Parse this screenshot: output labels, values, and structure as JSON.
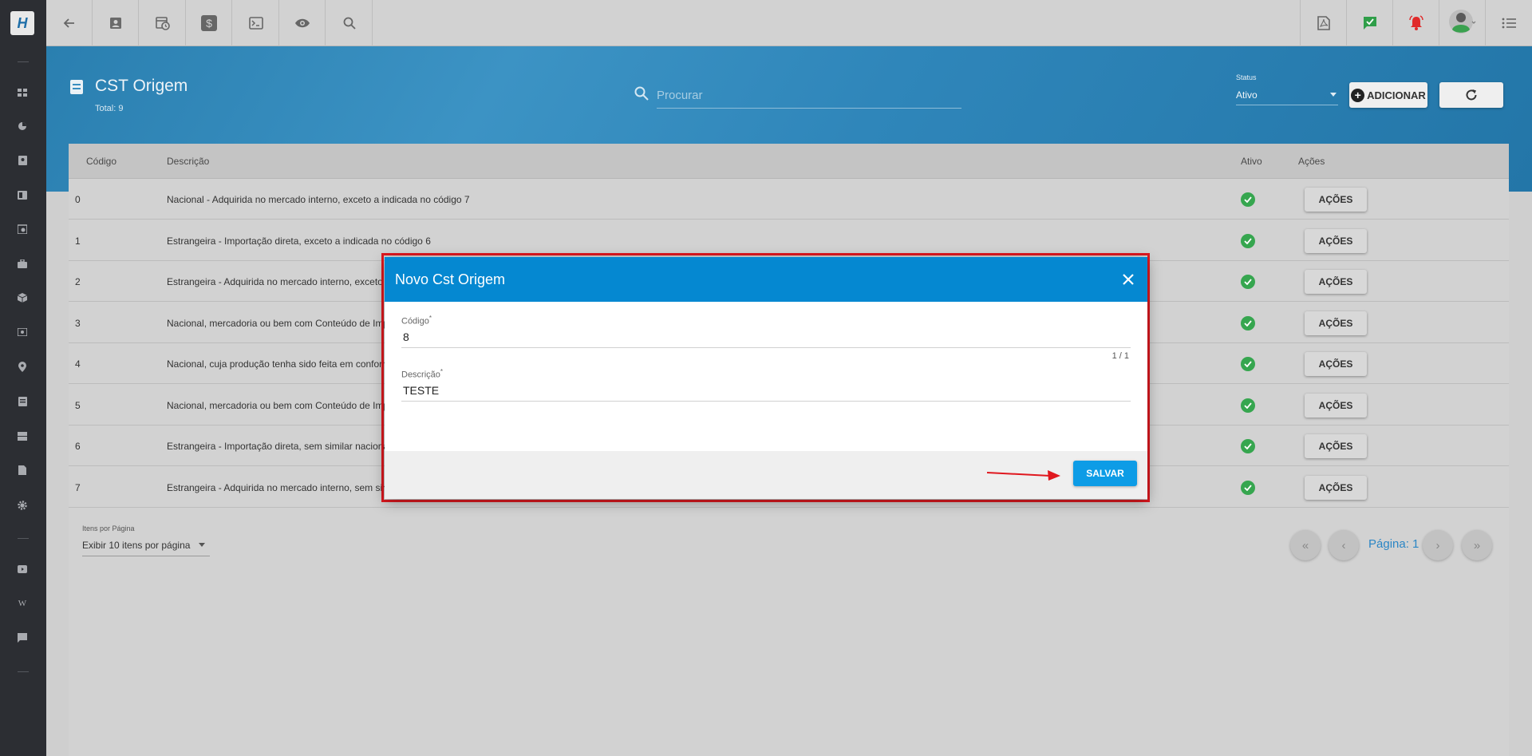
{
  "page": {
    "title": "CST Origem",
    "total": "Total: 9"
  },
  "search": {
    "placeholder": "Procurar"
  },
  "status": {
    "label": "Status",
    "value": "Ativo"
  },
  "buttons": {
    "add": "ADICIONAR"
  },
  "table": {
    "headers": {
      "code": "Código",
      "description": "Descrição",
      "active": "Ativo",
      "actions": "Ações"
    },
    "action_label": "AÇÕES",
    "rows": [
      {
        "code": "0",
        "description": "Nacional - Adquirida no mercado interno, exceto a indicada no código 7"
      },
      {
        "code": "1",
        "description": "Estrangeira - Importação direta, exceto a indicada no código 6"
      },
      {
        "code": "2",
        "description": "Estrangeira - Adquirida no mercado interno, exceto a"
      },
      {
        "code": "3",
        "description": "Nacional, mercadoria ou bem com Conteúdo de Impo"
      },
      {
        "code": "4",
        "description": "Nacional, cuja produção tenha sido feita em conform"
      },
      {
        "code": "5",
        "description": "Nacional, mercadoria ou bem com Conteúdo de Impo"
      },
      {
        "code": "6",
        "description": "Estrangeira - Importação direta, sem similar nacional"
      },
      {
        "code": "7",
        "description": "Estrangeira - Adquirida no mercado interno, sem simi"
      }
    ]
  },
  "pagination": {
    "items_per_page_label": "Itens por Página",
    "items_per_page_value": "Exibir 10 itens por página",
    "page_label": "Página: 1"
  },
  "modal": {
    "title": "Novo Cst Origem",
    "code_label": "Código",
    "code_value": "8",
    "code_counter": "1 / 1",
    "description_label": "Descrição",
    "description_value": "TESTE",
    "required_mark": "*",
    "save_label": "SALVAR"
  },
  "colors": {
    "primary": "#0588d1",
    "save": "#0d9ce6",
    "highlight": "#e0181f",
    "success": "#36a64f",
    "sidebar": "#2c2e33"
  },
  "icons": {
    "sidebar": [
      "dashboard-icon",
      "pie-chart-icon",
      "contact-icon",
      "board-icon",
      "schedule-icon",
      "briefcase-icon",
      "package-icon",
      "money-icon",
      "map-pin-icon",
      "document-icon",
      "server-icon",
      "file-icon",
      "gear-icon",
      "video-icon",
      "wiki-icon",
      "chat-icon"
    ],
    "topbar": [
      "back-arrow-icon",
      "contact-icon",
      "calendar-clock-icon",
      "dollar-icon",
      "terminal-icon",
      "eye-icon",
      "search-icon",
      "pdf-icon",
      "message-check-icon",
      "alarm-bell-icon",
      "avatar",
      "list-menu-icon"
    ]
  }
}
